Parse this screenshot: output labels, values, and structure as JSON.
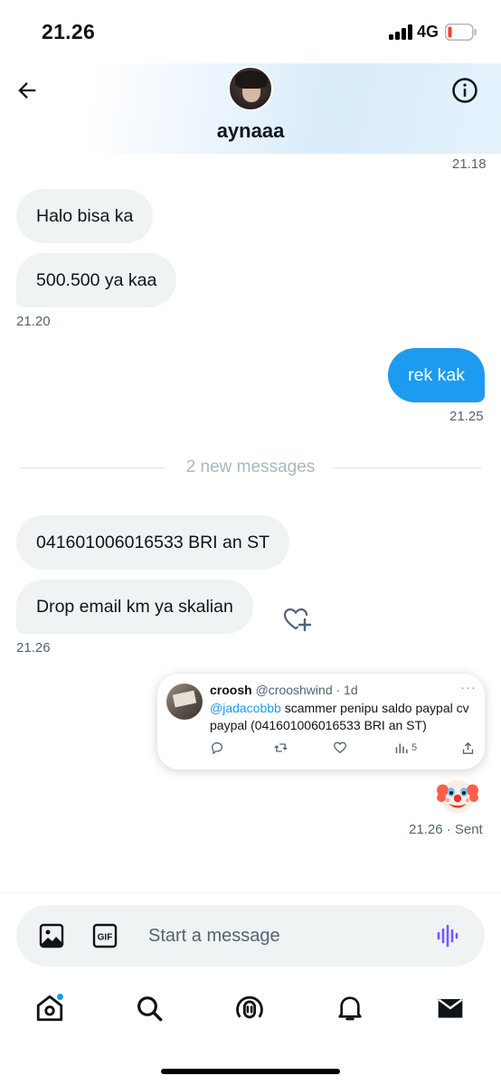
{
  "status_bar": {
    "time": "21.26",
    "network": "4G"
  },
  "header": {
    "contact_name": "aynaaa"
  },
  "messages": [
    {
      "timestamp": "21.18"
    },
    {
      "text": "Halo bisa ka"
    },
    {
      "text": "500.500 ya kaa",
      "timestamp": "21.20"
    },
    {
      "text": "rek kak",
      "timestamp": "21.25"
    },
    {
      "divider": "2 new messages"
    },
    {
      "text": "041601006016533 BRI an ST"
    },
    {
      "text": "Drop email km ya skalian",
      "timestamp": "21.26"
    }
  ],
  "shared_tweet": {
    "name": "croosh",
    "handle": "@crooshwind",
    "time": "· 1d",
    "mention": "@jadacobbb",
    "text": " scammer penipu saldo paypal cv paypal (041601006016533 BRI an ST)",
    "views": "5",
    "more": "···"
  },
  "last_message": {
    "emoji": "clown-face",
    "timestamp": "21.26 · Sent"
  },
  "composer": {
    "placeholder": "Start a message",
    "gif_label": "GIF"
  },
  "nav": [
    "home-icon",
    "search-icon",
    "spaces-icon",
    "notifications-icon",
    "messages-icon"
  ],
  "colors": {
    "accent": "#1d9bf0",
    "bubble_in": "#eff3f4",
    "voice": "#7856ff"
  }
}
